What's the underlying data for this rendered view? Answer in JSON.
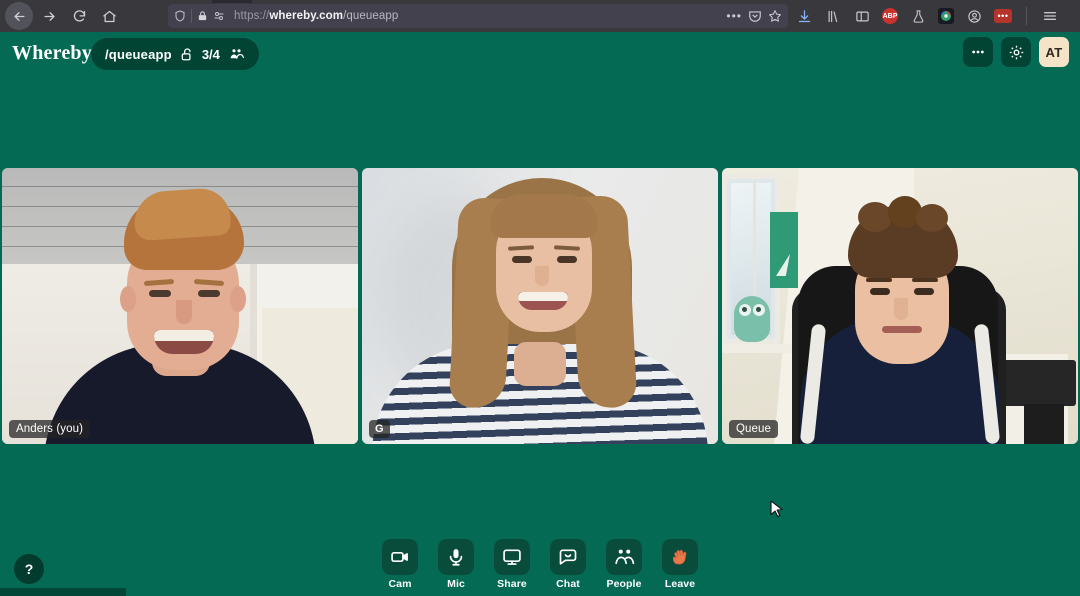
{
  "browser": {
    "url_protocol": "https://",
    "url_domain": "whereby.com",
    "url_path": "/queueapp",
    "nav": {
      "back": "back-arrow",
      "forward": "forward-arrow",
      "reload": "reload",
      "home": "home"
    },
    "urlbar_icons": [
      "shield-icon",
      "lock-icon",
      "permissions-icon",
      "tracking-icon"
    ],
    "urlbar_right_icons": [
      "page-actions-ellipsis",
      "pocket-icon",
      "bookmark-star-icon"
    ],
    "toolbar_icons": [
      "downloads-icon",
      "library-icon",
      "sidebar-icon",
      "adblock-extension-icon",
      "science-extension-icon",
      "colorful-extension-icon",
      "account-icon",
      "red-extension-icon",
      "hamburger-menu-icon"
    ],
    "adblock_label": "ABP",
    "red_ext_label": "•••"
  },
  "app": {
    "logo": "Whereby",
    "room": {
      "name": "/queueapp",
      "lock_state": "unlocked",
      "count": "3/4",
      "people_icon": "people-icon"
    },
    "header_actions": [
      {
        "name": "more-options-button",
        "icon": "ellipsis-icon",
        "label": "•••"
      },
      {
        "name": "settings-button",
        "icon": "gear-icon",
        "label": ""
      }
    ],
    "avatar": {
      "initials": "AT",
      "bg": "#f5e3c8"
    },
    "participants": [
      {
        "label": "Anders (you)",
        "scene": "anders",
        "self": true
      },
      {
        "label": "G",
        "scene": "g",
        "self": false
      },
      {
        "label": "Queue",
        "scene": "queue",
        "self": false
      }
    ],
    "toolbar": [
      {
        "name": "cam-button",
        "label": "Cam",
        "icon": "camera-icon"
      },
      {
        "name": "mic-button",
        "label": "Mic",
        "icon": "microphone-icon"
      },
      {
        "name": "share-button",
        "label": "Share",
        "icon": "monitor-icon"
      },
      {
        "name": "chat-button",
        "label": "Chat",
        "icon": "chat-bubble-icon"
      },
      {
        "name": "people-button",
        "label": "People",
        "icon": "people-icon"
      },
      {
        "name": "leave-button",
        "label": "Leave",
        "icon": "waving-hand-icon"
      }
    ],
    "help": {
      "label": "?"
    },
    "colors": {
      "background": "#046a54",
      "pill_dark": "#024433",
      "toolbar_button": "#0a4c3c",
      "accent_cream": "#f5e3c8",
      "leave_hand": "#e8794a"
    }
  }
}
